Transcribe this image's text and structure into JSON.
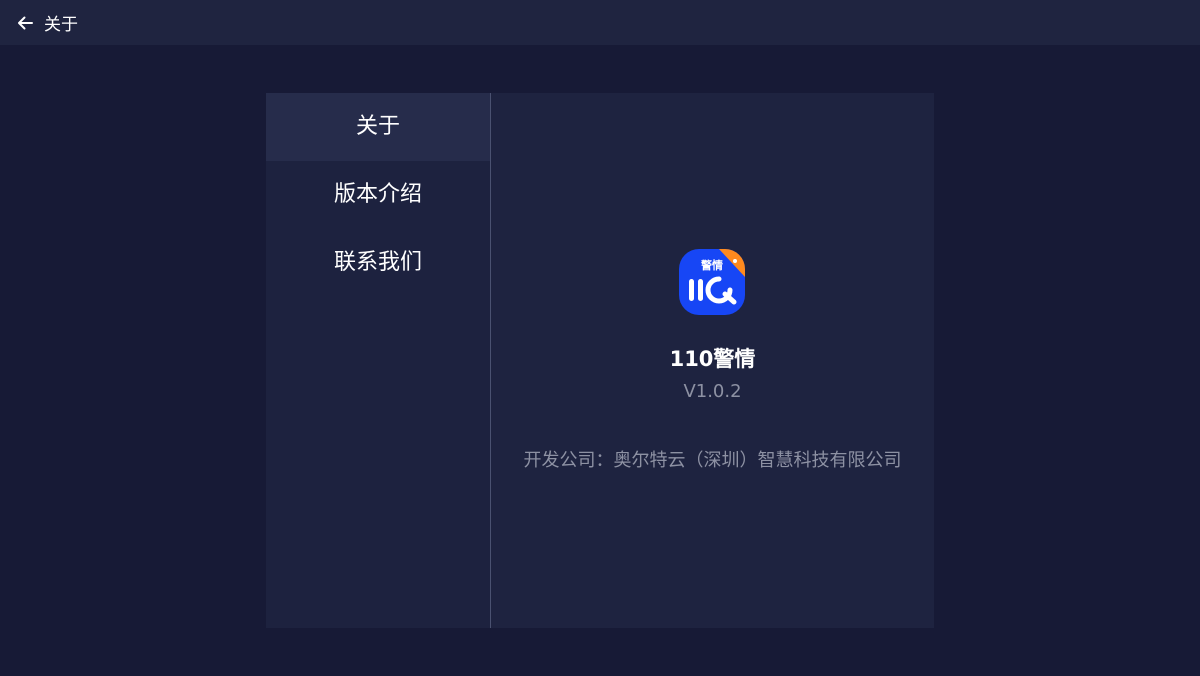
{
  "header": {
    "back_icon": "arrow-left-icon",
    "title": "关于"
  },
  "sidebar": {
    "items": [
      {
        "label": "关于",
        "active": true
      },
      {
        "label": "版本介绍",
        "active": false
      },
      {
        "label": "联系我们",
        "active": false
      }
    ]
  },
  "about": {
    "logo_text": "警情",
    "app_name": "110警情",
    "version": "V1.0.2",
    "company": "开发公司：奥尔特云（深圳）智慧科技有限公司"
  },
  "colors": {
    "background": "#171a36",
    "topbar": "#1f2440",
    "panel": "#1e2340",
    "active_item": "#262c4b",
    "logo_blue": "#1746f5",
    "logo_orange": "#ff8a1e",
    "muted_text": "#8d91a3"
  }
}
